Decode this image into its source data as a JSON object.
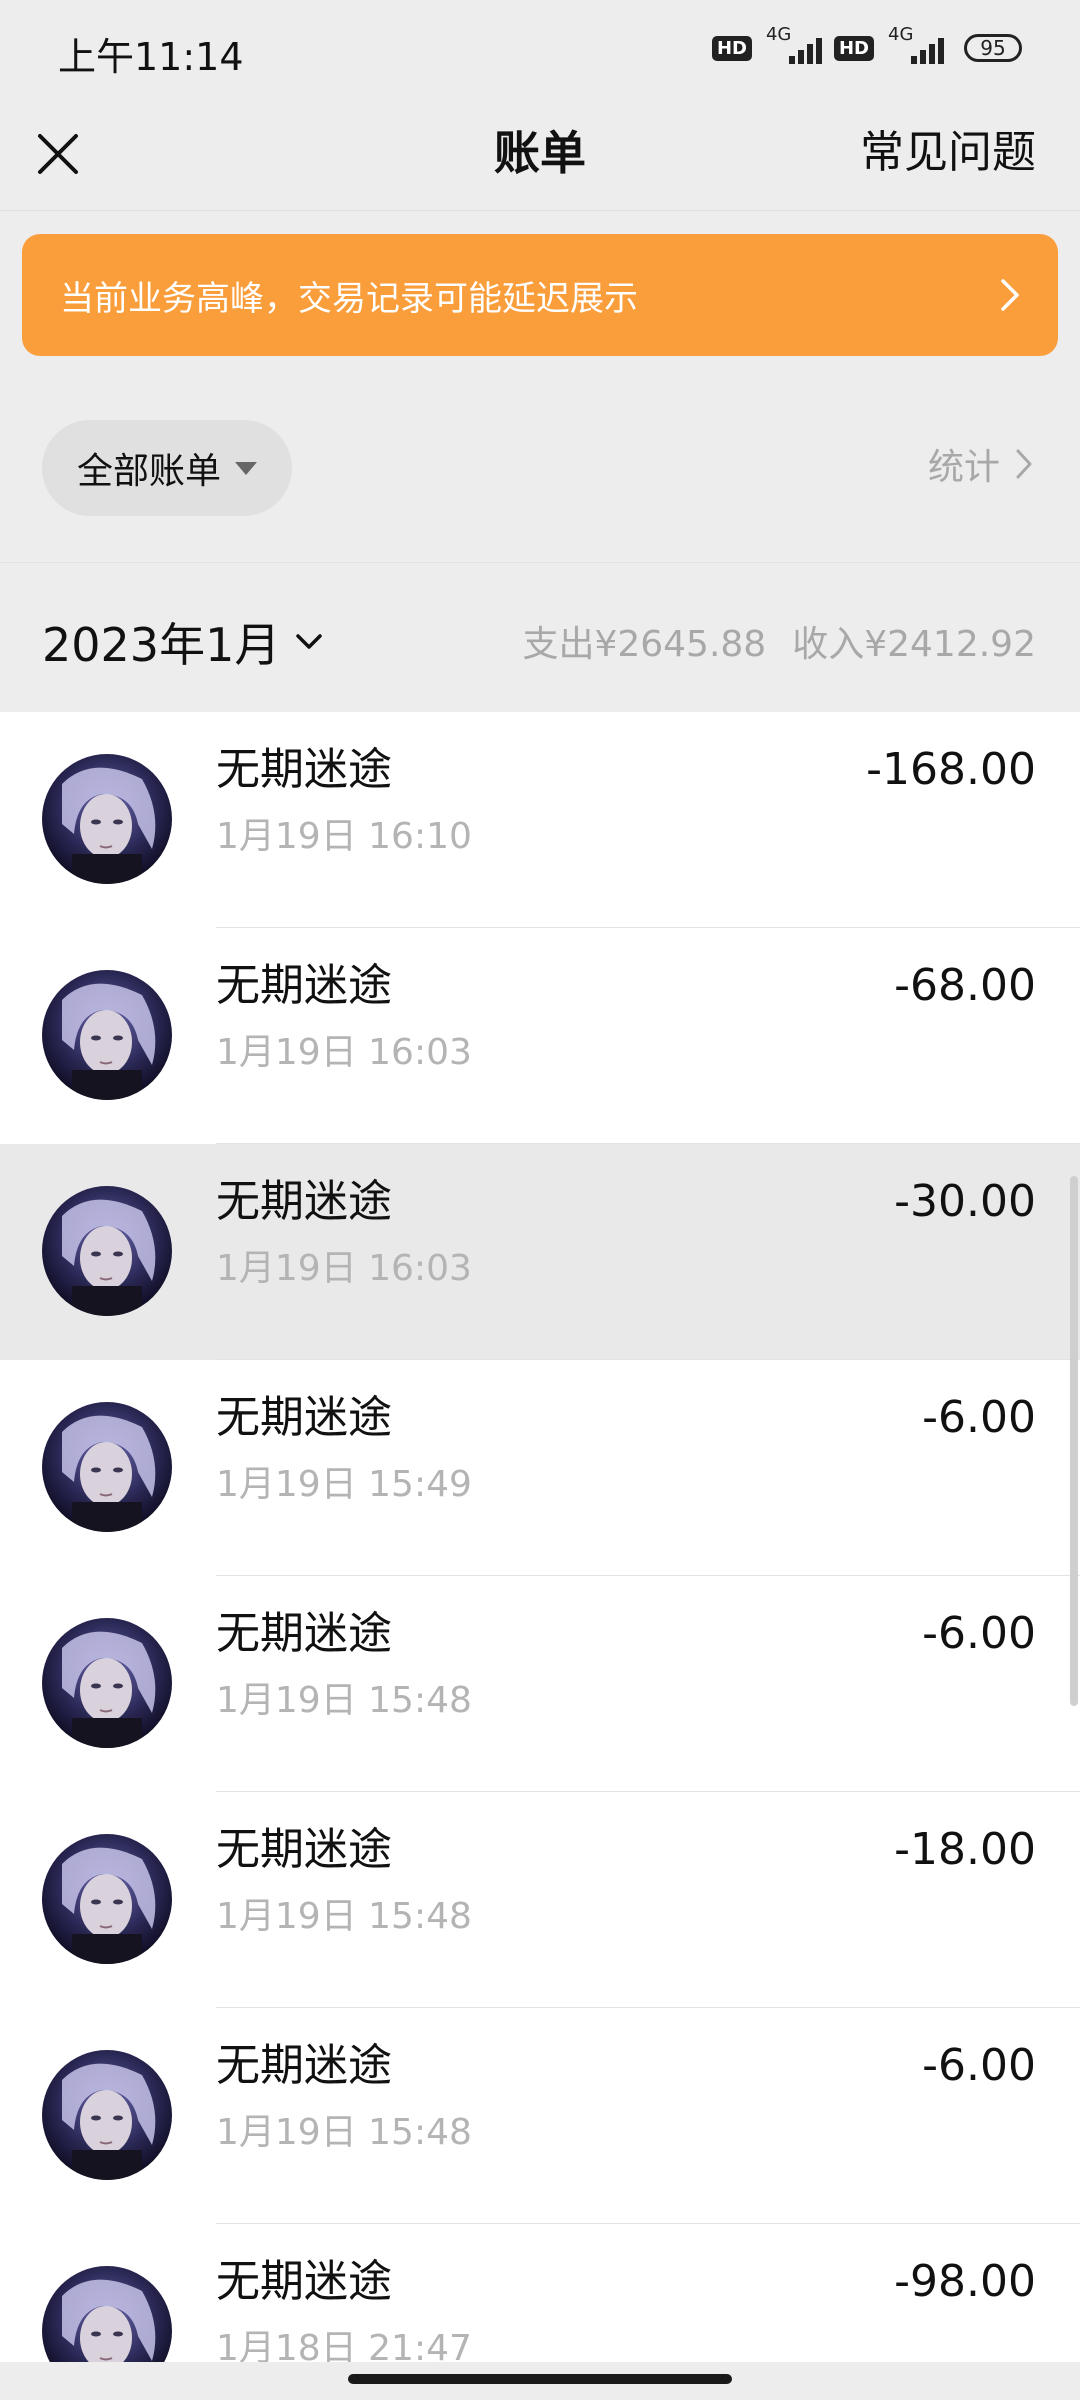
{
  "status_bar": {
    "time": "上午11:14",
    "network_1": "4G",
    "network_2": "4G",
    "hd": "HD",
    "battery": "95"
  },
  "nav": {
    "title": "账单",
    "faq_label": "常见问题",
    "close_icon": "close-icon"
  },
  "notice": {
    "text": "当前业务高峰，交易记录可能延迟展示",
    "color": "#fa9d3b"
  },
  "filter": {
    "label": "全部账单",
    "stats_label": "统计"
  },
  "month": {
    "label": "2023年1月",
    "expense": "支出¥2645.88",
    "income": "收入¥2412.92"
  },
  "transactions": [
    {
      "name": "无期迷途",
      "time": "1月19日 16:10",
      "amount": "-168.00"
    },
    {
      "name": "无期迷途",
      "time": "1月19日 16:03",
      "amount": "-68.00"
    },
    {
      "name": "无期迷途",
      "time": "1月19日 16:03",
      "amount": "-30.00"
    },
    {
      "name": "无期迷途",
      "time": "1月19日 15:49",
      "amount": "-6.00"
    },
    {
      "name": "无期迷途",
      "time": "1月19日 15:48",
      "amount": "-6.00"
    },
    {
      "name": "无期迷途",
      "time": "1月19日 15:48",
      "amount": "-18.00"
    },
    {
      "name": "无期迷途",
      "time": "1月19日 15:48",
      "amount": "-6.00"
    },
    {
      "name": "无期迷途",
      "time": "1月18日 21:47",
      "amount": "-98.00"
    }
  ]
}
